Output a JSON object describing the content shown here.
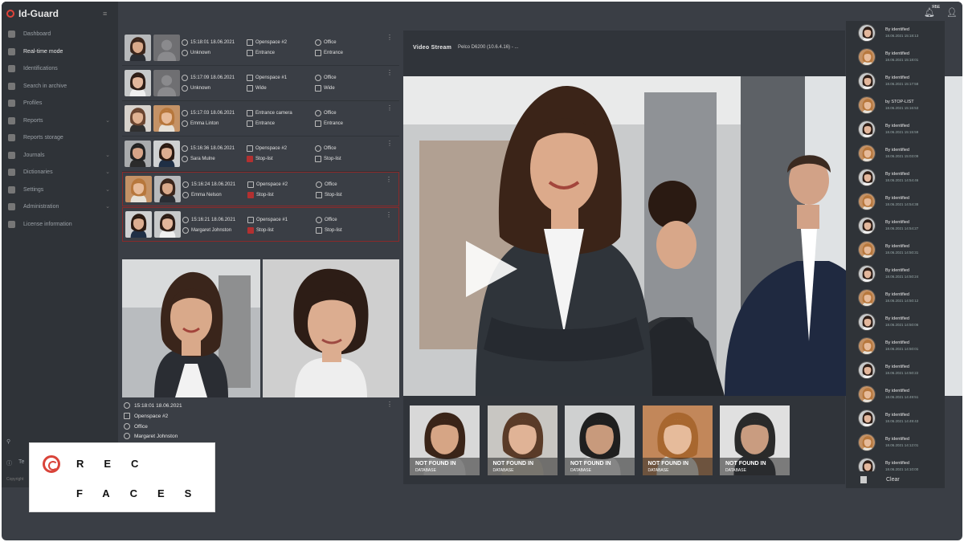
{
  "app": {
    "title": "Id-Guard"
  },
  "sidebar": {
    "items": [
      {
        "label": "Dashboard",
        "active": false,
        "chev": false
      },
      {
        "label": "Real-time mode",
        "active": true,
        "chev": false
      },
      {
        "label": "Identifications",
        "active": false,
        "chev": false
      },
      {
        "label": "Search in archive",
        "active": false,
        "chev": false
      },
      {
        "label": "Profiles",
        "active": false,
        "chev": false
      },
      {
        "label": "Reports",
        "active": false,
        "chev": true
      },
      {
        "label": "Reports storage",
        "active": false,
        "chev": false
      },
      {
        "label": "Journals",
        "active": false,
        "chev": true
      },
      {
        "label": "Dictionaries",
        "active": false,
        "chev": true
      },
      {
        "label": "Settings",
        "active": false,
        "chev": true
      },
      {
        "label": "Administration",
        "active": false,
        "chev": true
      },
      {
        "label": "License information",
        "active": false,
        "chev": false
      }
    ],
    "bottom_item": "Te",
    "copyright": "Copyright"
  },
  "header": {
    "badge": "ЯБЕ"
  },
  "events": [
    {
      "time": "15:18:01  18.06.2021",
      "camera": "Openspace #2",
      "location": "Office",
      "name": "Unknown",
      "status": "Entrance",
      "stop": false,
      "match": false
    },
    {
      "time": "15:17:09  18.06.2021",
      "camera": "Openspace #1",
      "location": "Office",
      "name": "Unknown",
      "status": "Wide",
      "stop": false,
      "match": false
    },
    {
      "time": "15:17:03  18.06.2021",
      "camera": "Entrance camera",
      "location": "Office",
      "name": "Emma Linton",
      "status": "Entrance",
      "stop": false,
      "match": true
    },
    {
      "time": "15:16:36  18.06.2021",
      "camera": "Openspace #2",
      "location": "Office",
      "name": "Sara Mulne",
      "status": "Stop-list",
      "stop": false,
      "match": true
    },
    {
      "time": "15:16:24  18.06.2021",
      "camera": "Openspace #2",
      "location": "Office",
      "name": "Emma Nelson",
      "status": "Stop-list",
      "stop": true,
      "match": true
    },
    {
      "time": "15:16:21  18.06.2021",
      "camera": "Openspace #1",
      "location": "Office",
      "name": "Margaret Johnston",
      "status": "Stop-list",
      "stop": true,
      "match": true
    }
  ],
  "detail": {
    "time": "15:18:01  18.06.2021",
    "camera": "Openspace #2",
    "location": "Office",
    "name": "Margaret Johnston"
  },
  "stream": {
    "title": "Video Stream",
    "select_value": "Pelco D6200 (10.6.4.16) - ..."
  },
  "not_found": [
    {
      "line1": "NOT FOUND IN",
      "line2": "DATABASE"
    },
    {
      "line1": "NOT FOUND IN",
      "line2": "DATABASE"
    },
    {
      "line1": "NOT FOUND IN",
      "line2": "DATABASE"
    },
    {
      "line1": "NOT FOUND IN",
      "line2": "DATABASE"
    },
    {
      "line1": "NOT FOUND IN",
      "line2": "DATABASE"
    }
  ],
  "notifications": [
    {
      "label": "By identified",
      "time": "18.06.2021 15:18:13"
    },
    {
      "label": "By identified",
      "time": "18.06.2021 15:18:01"
    },
    {
      "label": "By identified",
      "time": "18.06.2021 15:17:58"
    },
    {
      "label": "by STOP-LIST",
      "time": "18.06.2021 15:16:53"
    },
    {
      "label": "By identified",
      "time": "18.06.2021 15:15:59"
    },
    {
      "label": "By identified",
      "time": "18.06.2021 15:03:09"
    },
    {
      "label": "By identified",
      "time": "18.06.2021 14:54:46"
    },
    {
      "label": "By identified",
      "time": "18.06.2021 14:54:38"
    },
    {
      "label": "By identified",
      "time": "18.06.2021 14:54:27"
    },
    {
      "label": "By identified",
      "time": "18.06.2021 14:50:31"
    },
    {
      "label": "By identified",
      "time": "18.06.2021 14:50:24"
    },
    {
      "label": "By identified",
      "time": "18.06.2021 14:50:12"
    },
    {
      "label": "By identified",
      "time": "18.06.2021 14:50:06"
    },
    {
      "label": "By identified",
      "time": "18.06.2021 14:50:01"
    },
    {
      "label": "By identified",
      "time": "18.06.2021 14:50:22"
    },
    {
      "label": "By identified",
      "time": "18.06.2021 14:49:51"
    },
    {
      "label": "By identified",
      "time": "18.06.2021 14:49:43"
    },
    {
      "label": "By identified",
      "time": "18.06.2021 14:12:01"
    },
    {
      "label": "By identified",
      "time": "18.06.2021 14:10:00"
    }
  ],
  "clear_label": "Clear",
  "brand": {
    "line1": "REC",
    "line2": "FACES"
  },
  "colors": {
    "accent": "#e0443a",
    "stop": "#8a2a2a",
    "panel": "#3a3e45",
    "sidebar": "#2f3338"
  }
}
